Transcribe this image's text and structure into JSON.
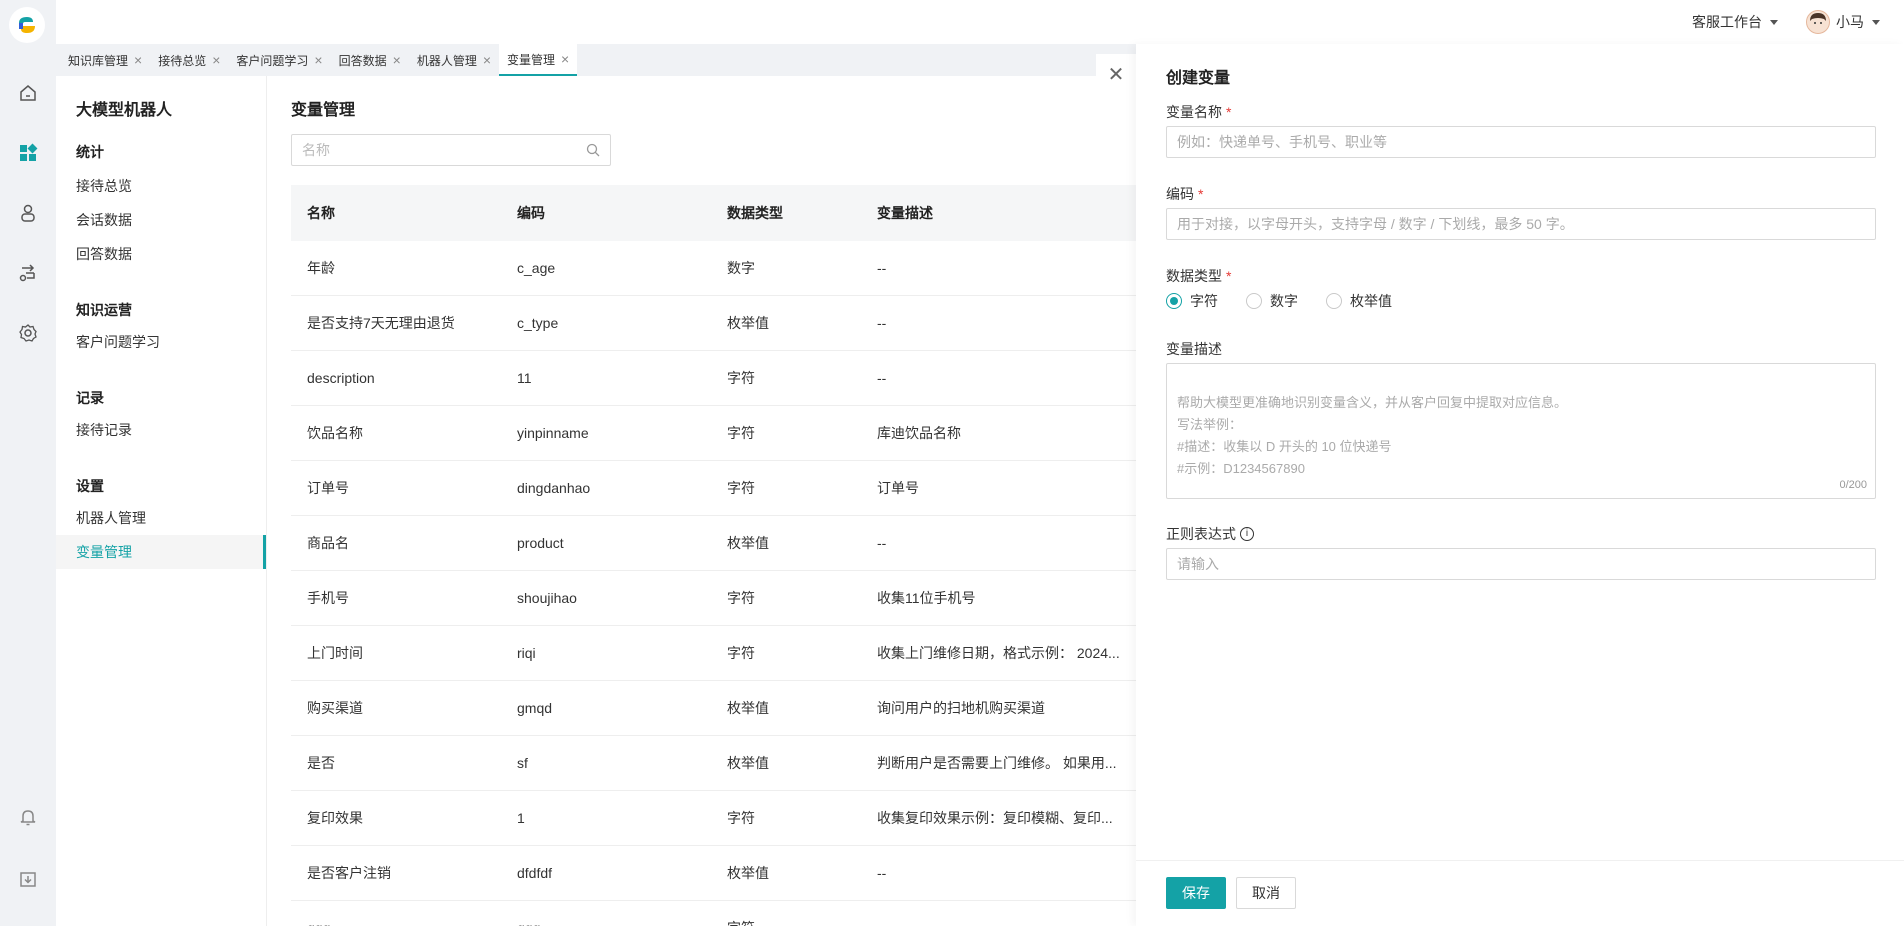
{
  "rail": {
    "icons": [
      "home-icon",
      "dashboard-icon",
      "robot-icon",
      "flow-icon",
      "settings-icon",
      "bell-icon",
      "download-icon"
    ]
  },
  "topbar": {
    "workspace": "客服工作台",
    "user": "小马"
  },
  "tabs": [
    {
      "label": "知识库管理",
      "active": false
    },
    {
      "label": "接待总览",
      "active": false
    },
    {
      "label": "客户问题学习",
      "active": false
    },
    {
      "label": "回答数据",
      "active": false
    },
    {
      "label": "机器人管理",
      "active": false
    },
    {
      "label": "变量管理",
      "active": true
    }
  ],
  "nav": {
    "title": "大模型机器人",
    "groups": [
      {
        "label": "统计",
        "items": [
          "接待总览",
          "会话数据",
          "回答数据"
        ]
      },
      {
        "label": "知识运营",
        "items": [
          "客户问题学习"
        ]
      },
      {
        "label": "记录",
        "items": [
          "接待记录"
        ]
      },
      {
        "label": "设置",
        "items": [
          "机器人管理",
          "变量管理"
        ]
      }
    ],
    "active_item": "变量管理"
  },
  "main": {
    "title": "变量管理",
    "search_placeholder": "名称",
    "columns": [
      "名称",
      "编码",
      "数据类型",
      "变量描述"
    ],
    "rows": [
      [
        "年龄",
        "c_age",
        "数字",
        "--"
      ],
      [
        "是否支持7天无理由退货",
        "c_type",
        "枚举值",
        "--"
      ],
      [
        "description",
        "11",
        "字符",
        "--"
      ],
      [
        "饮品名称",
        "yinpinname",
        "字符",
        "库迪饮品名称"
      ],
      [
        "订单号",
        "dingdanhao",
        "字符",
        "订单号"
      ],
      [
        "商品名",
        "product",
        "枚举值",
        "--"
      ],
      [
        "手机号",
        "shoujihao",
        "字符",
        "收集11位手机号"
      ],
      [
        "上门时间",
        "riqi",
        "字符",
        "收集上门维修日期，格式示例： 2024..."
      ],
      [
        "购买渠道",
        "gmqd",
        "枚举值",
        "询问用户的扫地机购买渠道"
      ],
      [
        "是否",
        "sf",
        "枚举值",
        "判断用户是否需要上门维修。 如果用..."
      ],
      [
        "复印效果",
        "1",
        "字符",
        "收集复印效果示例：复印模糊、复印..."
      ],
      [
        "是否客户注销",
        "dfdfdf",
        "枚举值",
        "--"
      ],
      [
        "ggg",
        "ggg",
        "字符",
        ""
      ]
    ]
  },
  "drawer": {
    "title": "创建变量",
    "name_label": "变量名称",
    "name_placeholder": "例如：快递单号、手机号、职业等",
    "code_label": "编码",
    "code_placeholder": "用于对接，以字母开头，支持字母 / 数字 / 下划线，最多 50 字。",
    "type_label": "数据类型",
    "type_options": [
      "字符",
      "数字",
      "枚举值"
    ],
    "type_selected": "字符",
    "desc_label": "变量描述",
    "desc_placeholder": "帮助大模型更准确地识别变量含义，并从客户回复中提取对应信息。\n写法举例：\n#描述：收集以 D 开头的 10 位快递号\n#示例：D1234567890",
    "desc_counter": "0/200",
    "regex_label": "正则表达式",
    "regex_placeholder": "请输入",
    "save": "保存",
    "cancel": "取消",
    "required_mark": "*"
  },
  "colors": {
    "accent": "#14a2a6",
    "required": "#e53935"
  }
}
